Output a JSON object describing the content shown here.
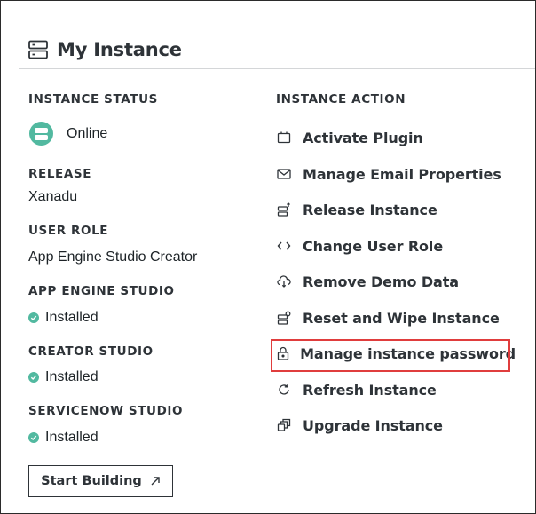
{
  "header": {
    "title": "My Instance"
  },
  "status": {
    "instance_status_label": "INSTANCE STATUS",
    "instance_status_value": "Online",
    "release_label": "RELEASE",
    "release_value": "Xanadu",
    "user_role_label": "USER ROLE",
    "user_role_value": "App Engine Studio Creator",
    "aes_label": "APP ENGINE STUDIO",
    "aes_value": "Installed",
    "creator_label": "CREATOR STUDIO",
    "creator_value": "Installed",
    "servicenow_label": "SERVICENOW STUDIO",
    "servicenow_value": "Installed",
    "start_building": "Start Building"
  },
  "actions": {
    "heading": "INSTANCE ACTION",
    "items": [
      {
        "label": "Activate Plugin",
        "icon": "plugin-icon"
      },
      {
        "label": "Manage Email Properties",
        "icon": "email-icon"
      },
      {
        "label": "Release Instance",
        "icon": "release-icon"
      },
      {
        "label": "Change User Role",
        "icon": "code-icon"
      },
      {
        "label": "Remove Demo Data",
        "icon": "cloud-icon"
      },
      {
        "label": "Reset and Wipe Instance",
        "icon": "reset-icon"
      },
      {
        "label": "Manage instance password",
        "icon": "lock-icon"
      },
      {
        "label": "Refresh Instance",
        "icon": "refresh-icon"
      },
      {
        "label": "Upgrade Instance",
        "icon": "upgrade-icon"
      }
    ]
  },
  "colors": {
    "accent": "#52b9a0",
    "highlight": "#e03d3d",
    "text": "#2e3338"
  }
}
